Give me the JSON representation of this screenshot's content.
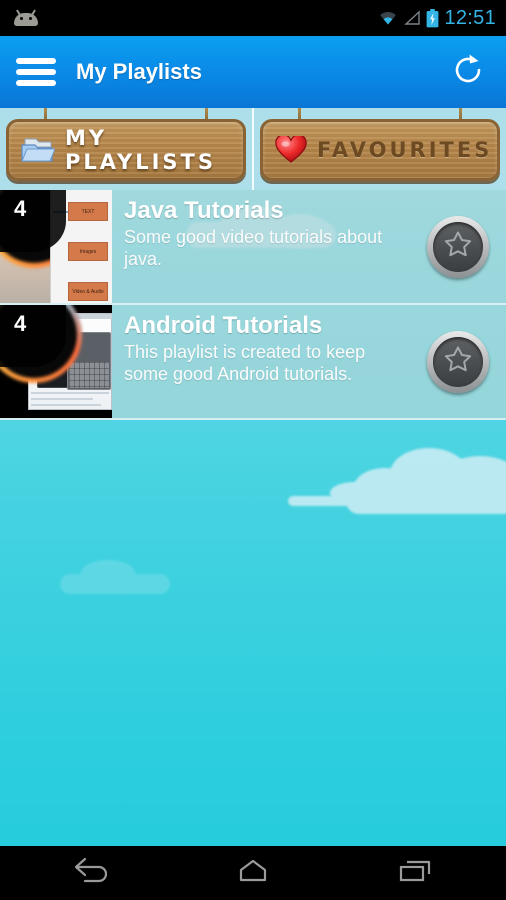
{
  "statusbar": {
    "notification_icon": "android-robot-icon",
    "wifi_icon": "wifi-icon",
    "signal_icon": "cell-signal-icon",
    "battery_icon": "battery-charging-icon",
    "time": "12:51",
    "time_color": "#33b5e5"
  },
  "actionbar": {
    "menu_icon": "hamburger-menu-icon",
    "title": "My Playlists",
    "refresh_icon": "refresh-icon",
    "accent": "#0a8ce8"
  },
  "tabs": [
    {
      "label": "MY PLAYLISTS",
      "icon": "folder-icon",
      "active": true
    },
    {
      "label": "FAVOURITES",
      "icon": "heart-icon",
      "active": false
    }
  ],
  "playlists": [
    {
      "title": "Java Tutorials",
      "description": "Some good video tutorials about java.",
      "count": "4",
      "favourite_icon": "star-icon",
      "thumbnail": "java-tutorial-thumbnail",
      "thumb_boxes": [
        "TEXT",
        "Images",
        "Video & Audio"
      ]
    },
    {
      "title": "Android Tutorials",
      "description": "This playlist is created to keep some good Android tutorials.",
      "count": "4",
      "favourite_icon": "star-icon",
      "thumbnail": "android-tutorial-thumbnail",
      "thumb_boxes": []
    }
  ],
  "navbar": {
    "back": "back-icon",
    "home": "home-icon",
    "recents": "recent-apps-icon"
  },
  "theme": {
    "sky_top": "#7adee8",
    "sky_bottom": "#26ccdc",
    "wood": "#b8894c",
    "row_overlay": "rgba(190,214,214,.62)"
  }
}
